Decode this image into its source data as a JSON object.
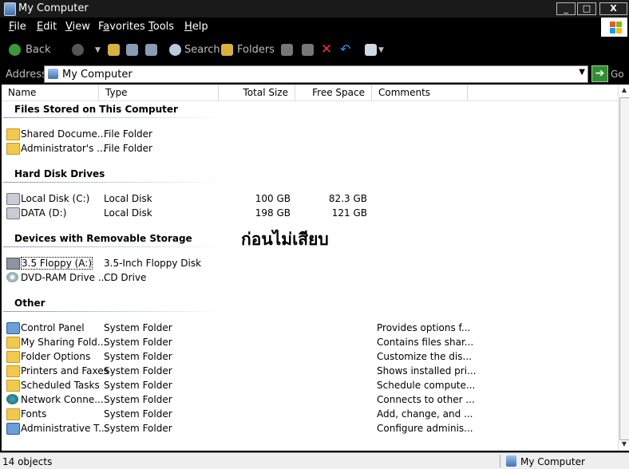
{
  "window": {
    "title": "My Computer",
    "minimize": "_",
    "maximize": "□",
    "close": "X"
  },
  "menu": [
    {
      "label": "File",
      "key": "F"
    },
    {
      "label": "Edit",
      "key": "E"
    },
    {
      "label": "View",
      "key": "V"
    },
    {
      "label": "Favorites",
      "key": "a"
    },
    {
      "label": "Tools",
      "key": "T"
    },
    {
      "label": "Help",
      "key": "H"
    }
  ],
  "toolbar": {
    "back": "Back",
    "search": "Search",
    "folders": "Folders"
  },
  "address": {
    "label": "Address",
    "value": "My Computer",
    "go": "Go"
  },
  "columns": {
    "name": "Name",
    "type": "Type",
    "total": "Total Size",
    "free": "Free Space",
    "comments": "Comments"
  },
  "groups": {
    "stored": "Files Stored on This Computer",
    "hdd": "Hard Disk Drives",
    "removable": "Devices with Removable Storage",
    "other": "Other"
  },
  "stored_items": [
    {
      "name": "Shared Docume...",
      "type": "File Folder",
      "icon": "folder-icon"
    },
    {
      "name": "Administrator's ...",
      "type": "File Folder",
      "icon": "folder-icon"
    }
  ],
  "hdd_items": [
    {
      "name": "Local Disk (C:)",
      "type": "Local Disk",
      "total": "100 GB",
      "free": "82.3 GB",
      "icon": "hard-disk-icon"
    },
    {
      "name": "DATA (D:)",
      "type": "Local Disk",
      "total": "198 GB",
      "free": "121 GB",
      "icon": "hard-disk-icon"
    }
  ],
  "removable_items": [
    {
      "name": "3.5 Floppy (A:)",
      "type": "3.5-Inch Floppy Disk",
      "icon": "floppy-icon"
    },
    {
      "name": "DVD-RAM Drive ...",
      "type": "CD Drive",
      "icon": "dvd-drive-icon"
    }
  ],
  "other_items": [
    {
      "name": "Control Panel",
      "type": "System Folder",
      "comment": "Provides options f...",
      "icon": "control-panel-icon"
    },
    {
      "name": "My Sharing Fold...",
      "type": "System Folder",
      "comment": "Contains files shar...",
      "icon": "sharing-folder-icon"
    },
    {
      "name": "Folder Options",
      "type": "System Folder",
      "comment": "Customize the dis...",
      "icon": "folder-options-icon"
    },
    {
      "name": "Printers and Faxes",
      "type": "System Folder",
      "comment": "Shows installed pri...",
      "icon": "printer-icon"
    },
    {
      "name": "Scheduled Tasks",
      "type": "System Folder",
      "comment": "Schedule compute...",
      "icon": "scheduled-tasks-icon"
    },
    {
      "name": "Network Conne...",
      "type": "System Folder",
      "comment": "Connects to other ...",
      "icon": "network-icon"
    },
    {
      "name": "Fonts",
      "type": "System Folder",
      "comment": "Add, change, and ...",
      "icon": "fonts-folder-icon"
    },
    {
      "name": "Administrative T...",
      "type": "System Folder",
      "comment": "Configure adminis...",
      "icon": "admin-tools-icon"
    }
  ],
  "overlay_text": "ก่อนไม่เสียบ",
  "status": {
    "count": "14 objects",
    "location": "My Computer"
  }
}
